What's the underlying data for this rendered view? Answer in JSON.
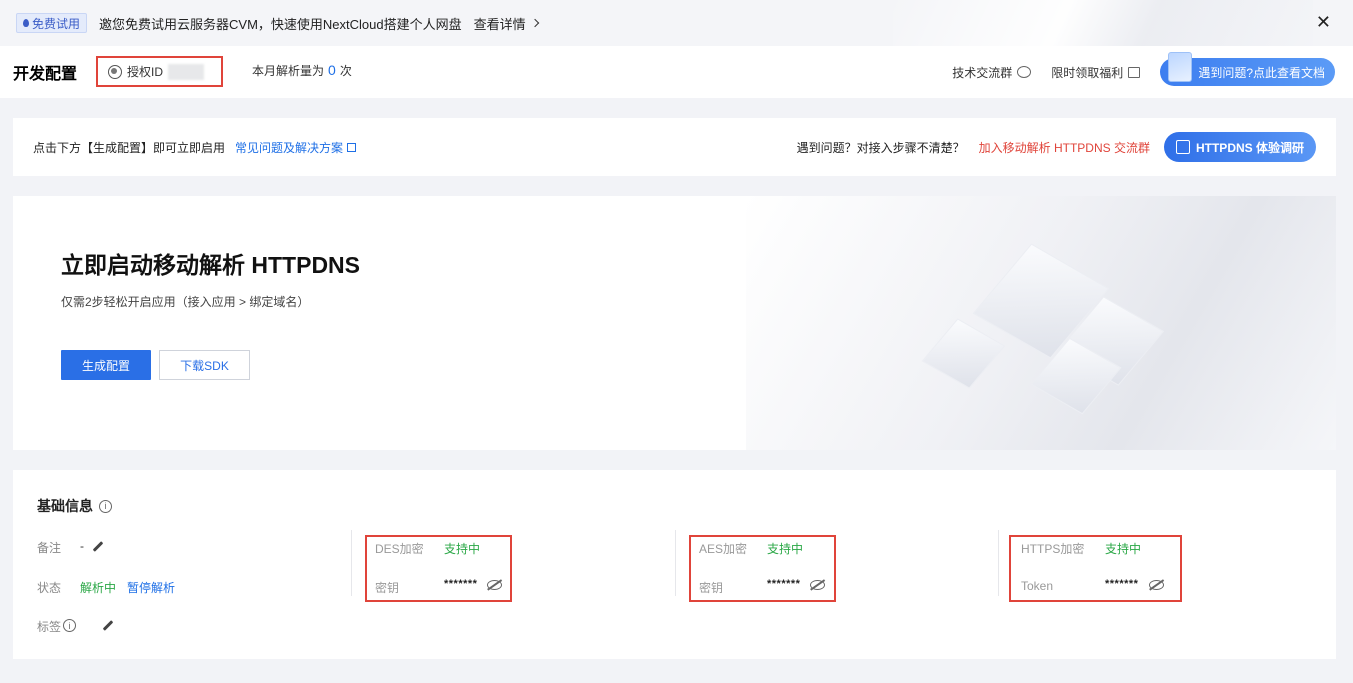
{
  "banner": {
    "badge": "免费试用",
    "text": "邀您免费试用云服务器CVM，快速使用NextCloud搭建个人网盘",
    "link": "查看详情",
    "close": "✕"
  },
  "header": {
    "title": "开发配置",
    "auth_label": "授权ID",
    "monthly_prefix": "本月解析量为",
    "monthly_count": "0",
    "monthly_suffix": "次",
    "tech_group": "技术交流群",
    "benefit": "限时领取福利",
    "doc_button": "遇到问题?点此查看文档"
  },
  "notice": {
    "text": "点击下方【生成配置】即可立即启用",
    "faq_link": "常见问题及解决方案",
    "question": "遇到问题？对接入步骤不清楚？",
    "join_group": "加入移动解析 HTTPDNS 交流群",
    "trial_button": "HTTPDNS 体验调研"
  },
  "hero": {
    "title": "立即启动移动解析 HTTPDNS",
    "subtitle": "仅需2步轻松开启应用（接入应用 > 绑定域名）",
    "primary_button": "生成配置",
    "secondary_button": "下载SDK"
  },
  "info": {
    "title": "基础信息",
    "remark_label": "备注",
    "remark_value": "-",
    "status_label": "状态",
    "status_value": "解析中",
    "pause_link": "暂停解析",
    "tags_label": "标签",
    "encryptions": [
      {
        "name": "DES加密",
        "status": "支持中",
        "key_label": "密钥",
        "masked": "*******"
      },
      {
        "name": "AES加密",
        "status": "支持中",
        "key_label": "密钥",
        "masked": "*******"
      },
      {
        "name": "HTTPS加密",
        "status": "支持中",
        "key_label": "Token",
        "masked": "*******"
      }
    ]
  },
  "colors": {
    "accent": "#1e6fe6",
    "primary_button": "#2a6fe6",
    "highlight_border": "#e0443a",
    "success": "#29a745",
    "danger_link": "#e0443a"
  },
  "icons": [
    "drop-icon",
    "chevron-right-icon",
    "close-icon",
    "globe-icon",
    "chat-icon",
    "gift-icon",
    "document-icon",
    "external-link-icon",
    "calendar-icon",
    "info-icon",
    "pencil-icon",
    "eye-off-icon"
  ]
}
